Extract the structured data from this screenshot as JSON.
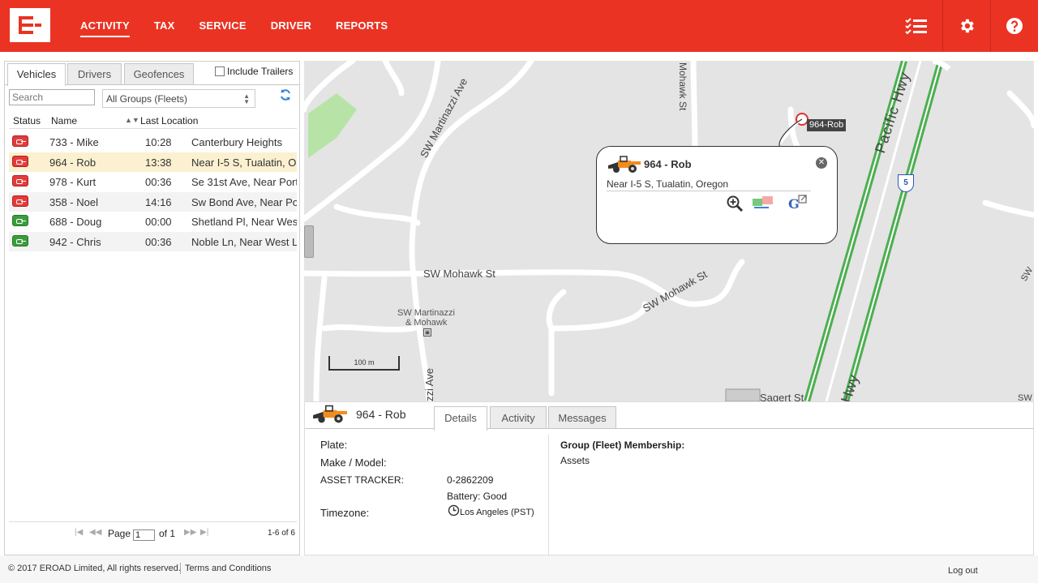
{
  "header": {
    "nav": [
      "ACTIVITY",
      "TAX",
      "SERVICE",
      "DRIVER",
      "REPORTS"
    ],
    "active_nav": "ACTIVITY",
    "accent_color": "#ea3323",
    "icons": [
      "checklist-icon",
      "gear-icon",
      "help-icon"
    ]
  },
  "left_panel": {
    "tabs": [
      "Vehicles",
      "Drivers",
      "Geofences"
    ],
    "active_tab": "Vehicles",
    "include_trailers_label": "Include Trailers",
    "search_placeholder": "Search",
    "group_select": "All Groups (Fleets)",
    "columns": [
      "Status",
      "Name",
      "Last Location"
    ],
    "vehicles": [
      {
        "status": "red",
        "name": "733 - Mike",
        "time": "10:28",
        "location": "Canterbury Heights"
      },
      {
        "status": "red",
        "name": "964 - Rob",
        "time": "13:38",
        "location": "Near I-5 S, Tualatin, Or"
      },
      {
        "status": "red",
        "name": "978 - Kurt",
        "time": "00:36",
        "location": "Se 31st Ave, Near Port"
      },
      {
        "status": "red",
        "name": "358 - Noel",
        "time": "14:16",
        "location": "Sw Bond Ave, Near Po"
      },
      {
        "status": "green",
        "name": "688 - Doug",
        "time": "00:00",
        "location": "Shetland Pl, Near Wes"
      },
      {
        "status": "green",
        "name": "942 - Chris",
        "time": "00:36",
        "location": "Noble Ln, Near West L"
      }
    ],
    "pager": {
      "page_label": "Page",
      "page": "1",
      "of_label": "of 1",
      "range": "1-6 of 6"
    }
  },
  "map": {
    "vehicle_label": "964-Rob",
    "popup": {
      "title": "964 - Rob",
      "address": "Near I-5 S, Tualatin, Oregon"
    },
    "streets": {
      "martinazzi": "SW Martinazzi Ave",
      "mohawk1": "SW Mohawk St",
      "mohawk2": "SW Mohawk St",
      "mohawk_top": "Mohawk St",
      "pacific": "Pacific Hwy",
      "hwy": "Hwy",
      "martinazzi_low": "zzi Ave",
      "sagert": "Sagert St",
      "stop_a": "SW Martinazzi",
      "stop_b": "& Mohawk",
      "sw_right": "SW",
      "sw_right2": "Sw",
      "sw_bottom": "SW Sagert St",
      "sw_bottom_r": "SW"
    },
    "i5_shield": "5",
    "scale": "100 m"
  },
  "details": {
    "title": "964 - Rob",
    "tabs": [
      "Details",
      "Activity",
      "Messages"
    ],
    "active_tab": "Details",
    "plate_label": "Plate:",
    "make_label": "Make / Model:",
    "tracker_label": "ASSET TRACKER:",
    "tracker_value": "0-2862209",
    "battery": "Battery: Good",
    "timezone_label": "Timezone:",
    "timezone_value": "Los Angeles (PST)",
    "group_label": "Group (Fleet) Membership:",
    "group_value": "Assets"
  },
  "footer": {
    "copyright": "© 2017 EROAD Limited, All rights reserved.",
    "terms": "Terms and Conditions",
    "logout": "Log out"
  }
}
